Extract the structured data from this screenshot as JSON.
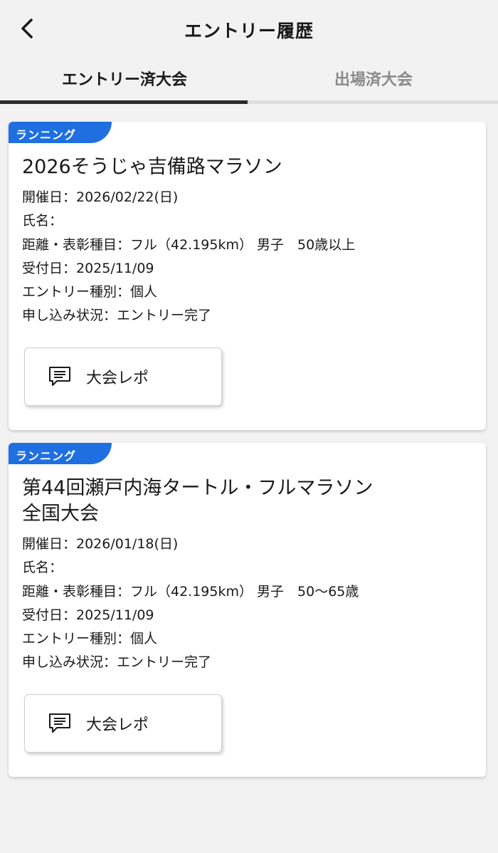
{
  "header": {
    "title": "エントリー履歴"
  },
  "tabs": [
    {
      "label": "エントリー済大会",
      "active": true
    },
    {
      "label": "出場済大会",
      "active": false
    }
  ],
  "colors": {
    "accent": "#1f6fe0",
    "background": "#f2f2f2",
    "tab_indicator": "#2a2a2a"
  },
  "entries": [
    {
      "tag": "ランニング",
      "title": "2026そうじゃ吉備路マラソン",
      "date": "開催日：2026/02/22(日)",
      "name": "氏名：",
      "distance": "距離・表彰種目：フル（42.195km） 男子　50歳以上",
      "received": "受付日：2025/11/09",
      "entry_type": "エントリー種別：個人",
      "status": "申し込み状況：エントリー完了",
      "report_button": "大会レポ"
    },
    {
      "tag": "ランニング",
      "title": "第44回瀬戸内海タートル・フルマラソン全国大会",
      "date": "開催日：2026/01/18(日)",
      "name": "氏名：",
      "distance": "距離・表彰種目：フル（42.195km） 男子　50〜65歳",
      "received": "受付日：2025/11/09",
      "entry_type": "エントリー種別：個人",
      "status": "申し込み状況：エントリー完了",
      "report_button": "大会レポ"
    }
  ]
}
